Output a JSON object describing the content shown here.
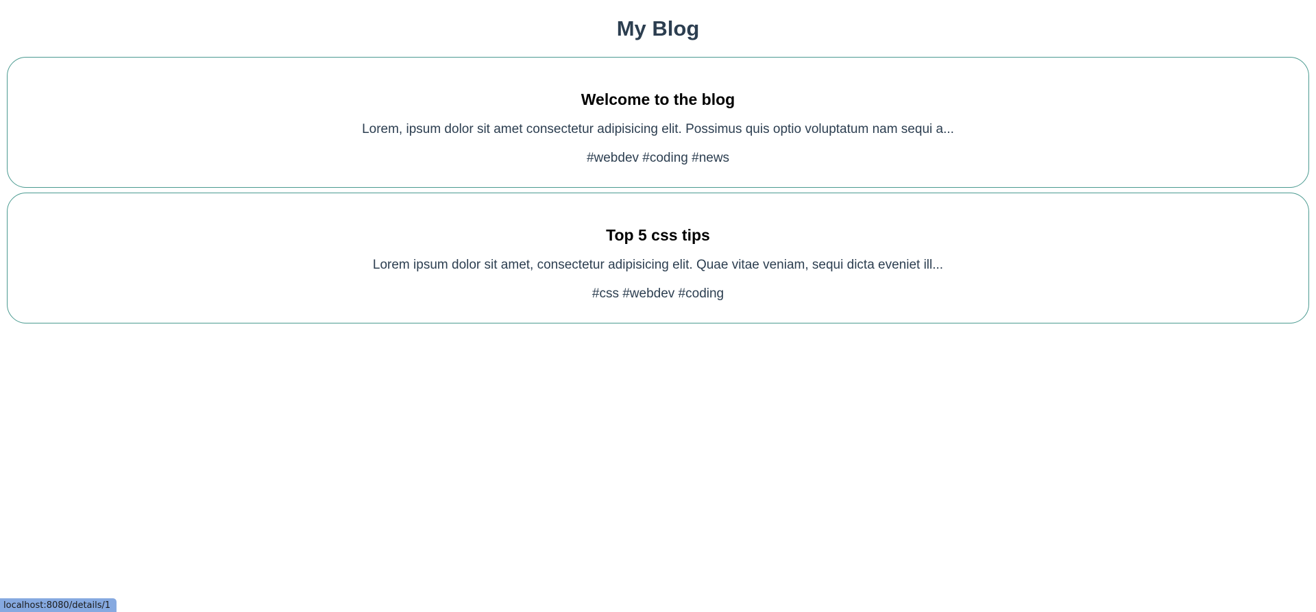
{
  "header": {
    "title": "My Blog"
  },
  "posts": [
    {
      "title": "Welcome to the blog",
      "snippet": "Lorem, ipsum dolor sit amet consectetur adipisicing elit. Possimus quis optio voluptatum nam sequi a...",
      "tags": "#webdev #coding #news"
    },
    {
      "title": "Top 5 css tips",
      "snippet": "Lorem ipsum dolor sit amet, consectetur adipisicing elit. Quae vitae veniam, sequi dicta eveniet ill...",
      "tags": "#css #webdev #coding"
    }
  ],
  "status_bar": {
    "url": "localhost:8080/details/1"
  },
  "colors": {
    "heading": "#2c3e50",
    "card_border": "#4a9a90",
    "status_bar_bg": "#86a9e0"
  }
}
